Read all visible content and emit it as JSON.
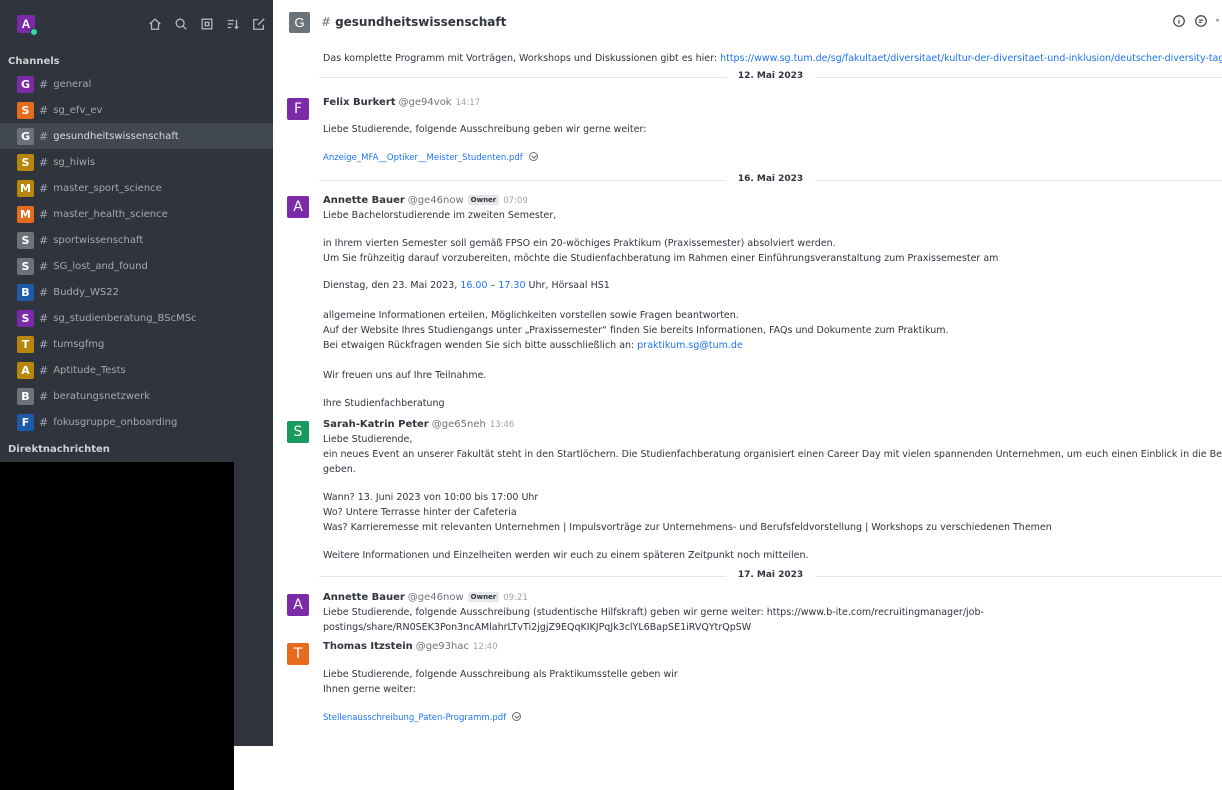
{
  "sidebar": {
    "user_initial": "A",
    "channels_label": "Channels",
    "direct_label": "Direktnachrichten",
    "channels": [
      {
        "initial": "G",
        "name": "general",
        "color": "#7b2aa8"
      },
      {
        "initial": "S",
        "name": "sg_efv_ev",
        "color": "#e66b1c"
      },
      {
        "initial": "G",
        "name": "gesundheitswissenschaft",
        "color": "#6c727a"
      },
      {
        "initial": "S",
        "name": "sg_hiwis",
        "color": "#b8860b"
      },
      {
        "initial": "M",
        "name": "master_sport_science",
        "color": "#b8860b"
      },
      {
        "initial": "M",
        "name": "master_health_science",
        "color": "#e66b1c"
      },
      {
        "initial": "S",
        "name": "sportwissenschaft",
        "color": "#6c727a"
      },
      {
        "initial": "S",
        "name": "SG_lost_and_found",
        "color": "#6c727a"
      },
      {
        "initial": "B",
        "name": "Buddy_WS22",
        "color": "#1d5ba8"
      },
      {
        "initial": "S",
        "name": "sg_studienberatung_BScMSc",
        "color": "#7b2aa8"
      },
      {
        "initial": "T",
        "name": "tumsgfmg",
        "color": "#b8860b"
      },
      {
        "initial": "A",
        "name": "Aptitude_Tests",
        "color": "#b8860b"
      },
      {
        "initial": "B",
        "name": "beratungsnetzwerk",
        "color": "#6c727a"
      },
      {
        "initial": "F",
        "name": "fokusgruppe_onboarding",
        "color": "#1d5ba8"
      }
    ]
  },
  "header": {
    "initial": "G",
    "hash": "#",
    "title": "gesundheitswissenschaft"
  },
  "messages": {
    "intro_text": "Das komplette Programm mit Vorträgen, Workshops und Diskussionen gibt es hier: ",
    "intro_link": "https://www.sg.tum.de/sg/fakultaet/diversitaet/kultur-der-diversitaet-und-inklusion/deutscher-diversity-tag",
    "date1": "12. Mai 2023",
    "m1": {
      "initial": "F",
      "name": "Felix Burkert",
      "user": "@ge94vok",
      "time": "14:17",
      "text": "Liebe Studierende, folgende Ausschreibung geben wir gerne weiter:",
      "file": "Anzeige_MFA__Optiker__Meister_Studenten.pdf"
    },
    "date2": "16. Mai 2023",
    "m2": {
      "initial": "A",
      "name": "Annette Bauer",
      "user": "@ge46now",
      "role": "Owner",
      "time": "07:09",
      "l1": "Liebe Bachelorstudierende im zweiten Semester,",
      "l2": "in Ihrem vierten Semester soll gemäß FPSO ein 20-wöchiges Praktikum (Praxissemester) absolviert werden.",
      "l3": "Um Sie frühzeitig darauf vorzubereiten, möchte die Studienfachberatung im Rahmen einer Einführungsveranstaltung zum Praxissemester am",
      "l4a": "Dienstag, den 23. Mai 2023, ",
      "l4b": "16.00",
      "l4c": " – ",
      "l4d": "17.30",
      "l4e": " Uhr, Hörsaal HS1",
      "l5": "allgemeine Informationen erteilen, Möglichkeiten vorstellen sowie Fragen beantworten.",
      "l6": "Auf der Website Ihres Studiengangs unter „Praxissemester“ finden Sie bereits Informationen, FAQs und Dokumente zum Praktikum.",
      "l7a": "Bei etwaigen Rückfragen wenden Sie sich bitte ausschließlich an: ",
      "l7b": "praktikum.sg@tum.de",
      "l8": "Wir freuen uns auf Ihre Teilnahme.",
      "l9": "Ihre Studienfachberatung"
    },
    "m3": {
      "initial": "S",
      "name": "Sarah-Katrin Peter",
      "user": "@ge65neh",
      "time": "13:46",
      "l1": "Liebe Studierende,",
      "l2": "ein neues Event an unserer Fakultät steht in den Startlöchern. Die Studienfachberatung organisiert einen Career Day mit vielen spannenden Unternehmen, um euch einen Einblick in die Berufswelt nach d",
      "l3": "geben.",
      "l4": "Wann? 13. Juni 2023 von 10:00 bis 17:00 Uhr",
      "l5": "Wo? Untere Terrasse hinter der Cafeteria",
      "l6": "Was? Karrieremesse mit relevanten Unternehmen | Impulsvorträge zur Unternehmens- und Berufsfeldvorstellung | Workshops zu verschiedenen Themen",
      "l7": "Weitere Informationen und Einzelheiten werden wir euch zu einem späteren Zeitpunkt noch mitteilen."
    },
    "date3": "17. Mai 2023",
    "m4": {
      "initial": "A",
      "name": "Annette Bauer",
      "user": "@ge46now",
      "role": "Owner",
      "time": "09:21",
      "l1": "Liebe Studierende, folgende Ausschreibung (studentische Hilfskraft) geben wir gerne weiter: https://www.b-ite.com/recruitingmanager/job-",
      "l2": "postings/share/RN0SEK3Pon3ncAMlahrLTvTi2jgjZ9EQqKIKJPqJk3clYL6BapSE1iRVQYtrQpSW"
    },
    "m5": {
      "initial": "T",
      "name": "Thomas Itzstein",
      "user": "@ge93hac",
      "time": "12:40",
      "l1": "Liebe Studierende, folgende Ausschreibung als Praktikumsstelle geben wir",
      "l2": "Ihnen gerne weiter:",
      "file": "Stellenausschreibung_Paten-Programm.pdf"
    }
  }
}
